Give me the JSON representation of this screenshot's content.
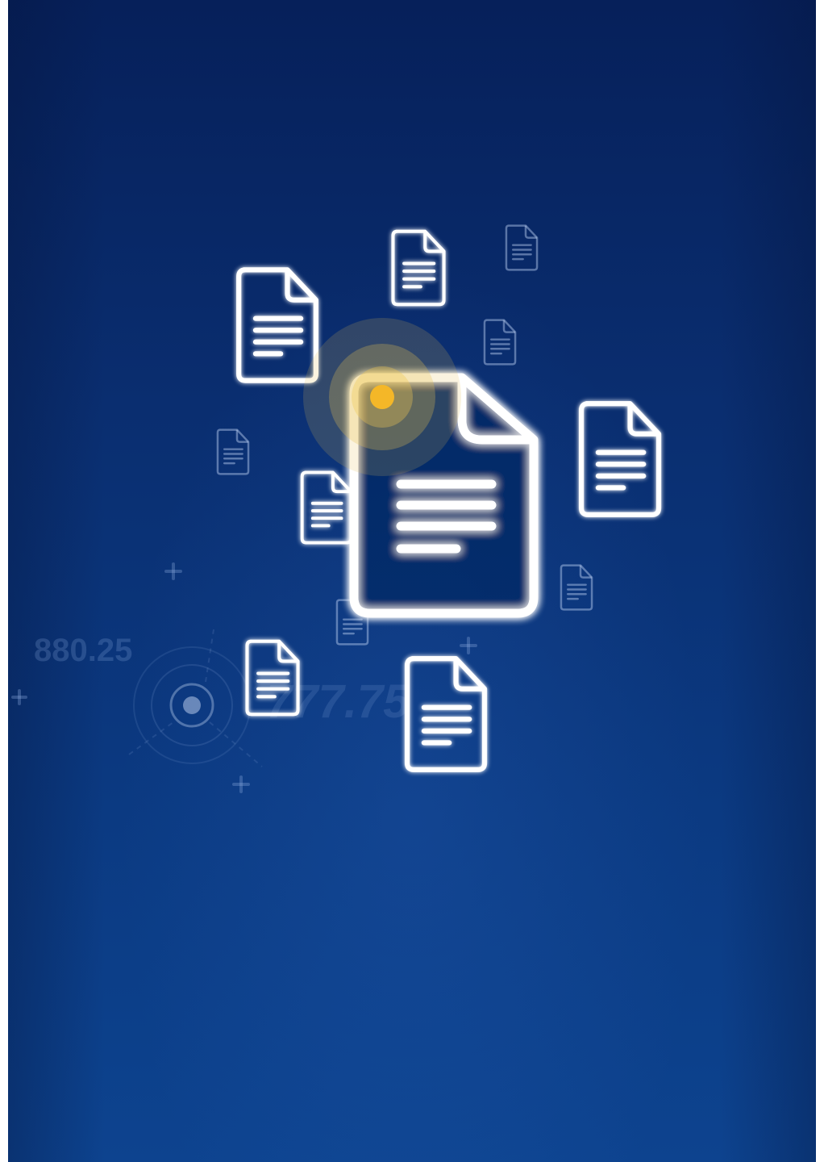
{
  "decorative_numbers": {
    "left_value": "880.25",
    "center_value": "777.75"
  },
  "icons": [
    "main-document-icon",
    "document-icon"
  ],
  "colors": {
    "background_top": "#06205a",
    "background_bottom": "#0d438f",
    "glow_white": "#ffffff",
    "accent_dot": "#f4b728"
  }
}
